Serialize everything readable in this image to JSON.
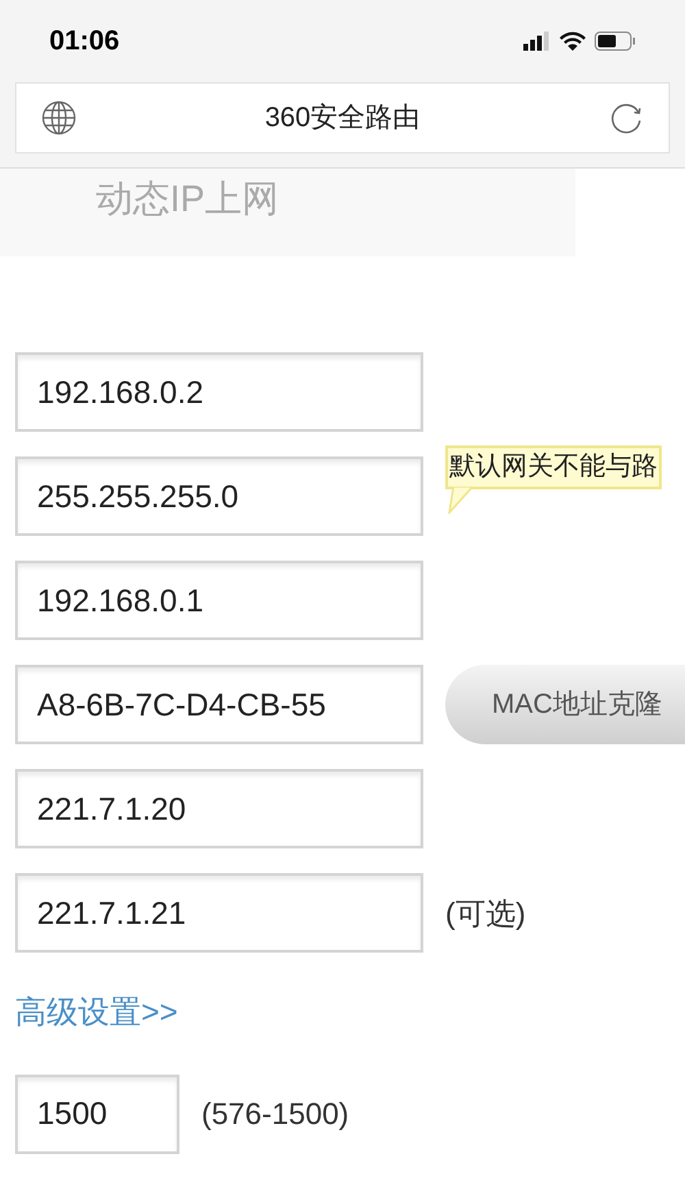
{
  "status_bar": {
    "time": "01:06"
  },
  "address_bar": {
    "title": "360安全路由"
  },
  "section_tab": {
    "label": "动态IP上网"
  },
  "fields": [
    {
      "value": "192.168.0.2"
    },
    {
      "value": "255.255.255.0",
      "tooltip": "默认网关不能与路"
    },
    {
      "value": "192.168.0.1"
    },
    {
      "value": "A8-6B-7C-D4-CB-55",
      "button": "MAC地址克隆"
    },
    {
      "value": "221.7.1.20"
    },
    {
      "value": "221.7.1.21",
      "note": "(可选)"
    }
  ],
  "advanced_link": "高级设置>>",
  "mtu": {
    "value": "1500",
    "note": "(576-1500)"
  }
}
